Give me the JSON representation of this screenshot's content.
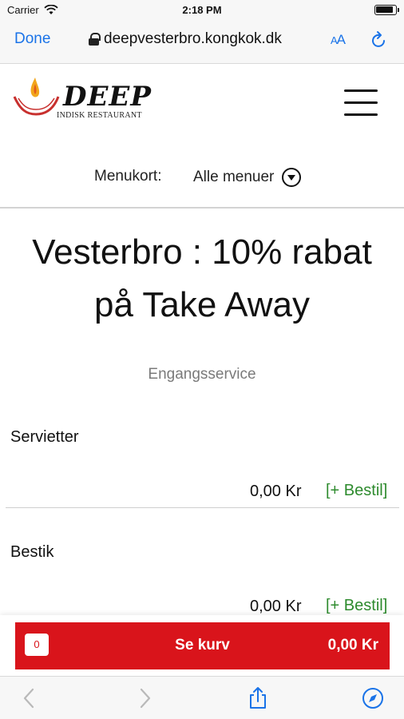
{
  "status_bar": {
    "carrier": "Carrier",
    "time": "2:18 PM"
  },
  "browser": {
    "done_label": "Done",
    "url": "deepvesterbro.kongkok.dk",
    "reader_label_large": "A",
    "reader_label_small": "A"
  },
  "site": {
    "logo_title": "DEEP",
    "logo_subtitle": "INDISK RESTAURANT"
  },
  "menu_selector": {
    "label": "Menukort:",
    "selected": "Alle menuer"
  },
  "page": {
    "title": "Vesterbro : 10% rabat på Take Away",
    "section": "Engangsservice"
  },
  "items": [
    {
      "name": "Servietter",
      "price": "0,00 Kr",
      "order_label": "[+ Bestil]"
    },
    {
      "name": "Bestik",
      "price": "0,00 Kr",
      "order_label": "[+ Bestil]"
    }
  ],
  "cart": {
    "count": "0",
    "label": "Se kurv",
    "total": "0,00 Kr"
  },
  "colors": {
    "accent_red": "#d9141b",
    "link_blue": "#1a73e8",
    "order_green": "#2e8b2e"
  },
  "icons": [
    "wifi-icon",
    "battery-icon",
    "lock-icon",
    "reload-icon",
    "hamburger-menu-icon",
    "dropdown-arrow-icon",
    "back-arrow-icon",
    "forward-arrow-icon",
    "share-icon",
    "compass-icon"
  ]
}
